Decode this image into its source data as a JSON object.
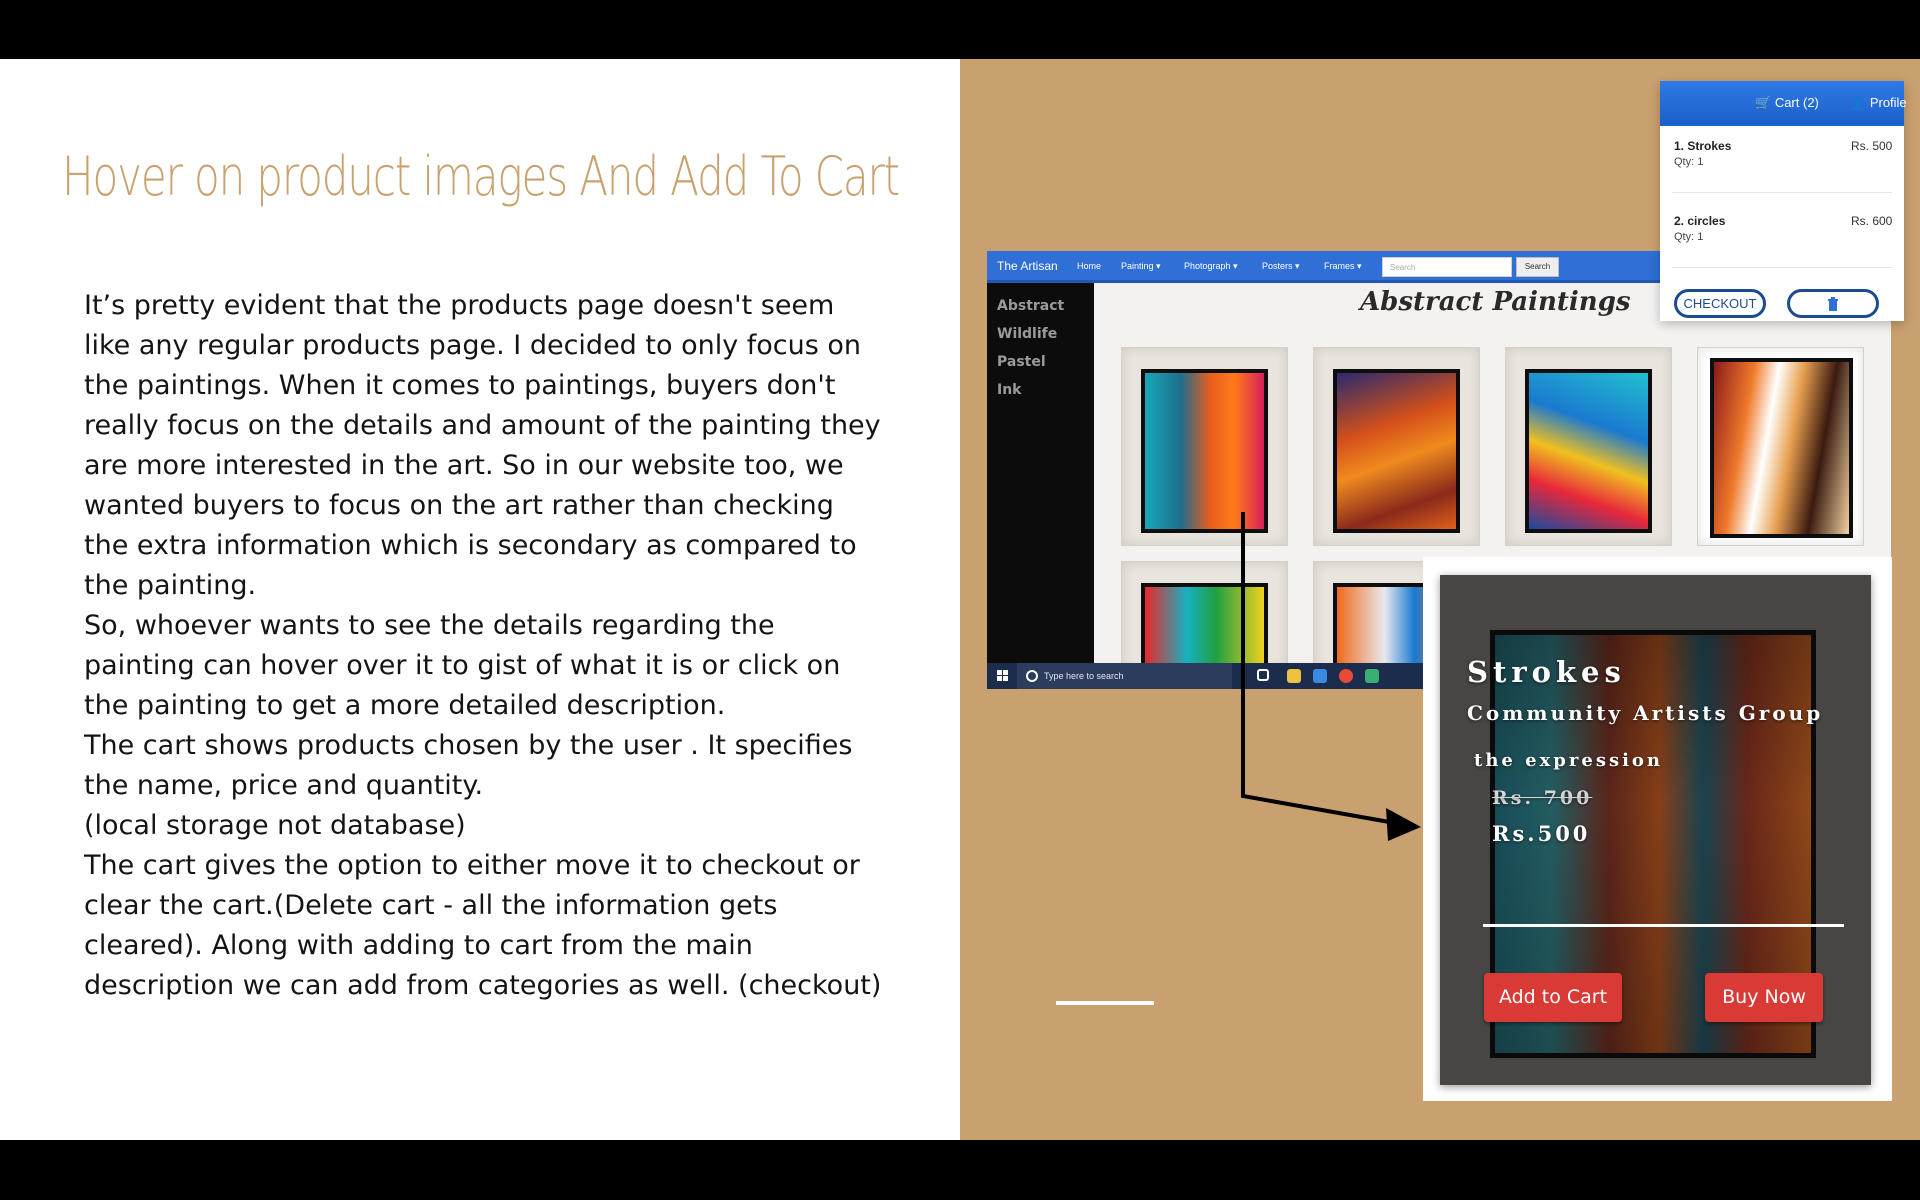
{
  "slide": {
    "title": "Hover on product images And Add To Cart",
    "paragraphs": [
      "It’s pretty evident that the products page doesn't seem like any regular products page. I decided to only focus on the paintings. When it comes to paintings, buyers don't really focus on the details and amount of the painting they are more interested in the art. So in our website too, we wanted buyers to focus on the art rather than checking the extra information which is secondary as compared to the painting.",
      "So, whoever wants to see the details regarding the painting can hover over it to gist of what it is or click on the painting to get a more detailed description.",
      "The cart shows products chosen by the user . It specifies the name, price and quantity.",
      "(local storage not database)",
      "The cart gives the option to either move it to checkout or clear the cart.(Delete cart -  all the information gets cleared). Along with adding to cart from the main description we can add from categories as well. (checkout)"
    ]
  },
  "site": {
    "brand": "The Artisan",
    "nav": [
      "Home",
      "Painting ▾",
      "Photograph ▾",
      "Posters ▾",
      "Frames ▾"
    ],
    "search_placeholder": "Search",
    "search_button": "Search",
    "sidebar": [
      "Abstract",
      "Wildlife",
      "Pastel",
      "Ink"
    ],
    "heading": "Abstract Paintings",
    "taskbar_search": "Type here to search"
  },
  "cart": {
    "cart_label": "Cart (2)",
    "profile_label": "Profile",
    "items": [
      {
        "name": "1. Strokes",
        "qty": "Qty: 1",
        "price": "Rs. 500"
      },
      {
        "name": "2. circles",
        "qty": "Qty: 1",
        "price": "Rs. 600"
      }
    ],
    "checkout": "CHECKOUT",
    "delete_icon": "trash-icon"
  },
  "hover_card": {
    "title": "Strokes",
    "artist": "Community Artists Group",
    "subtitle": "the expression",
    "old_price": "Rs. 700",
    "price": "Rs.500",
    "add_to_cart": "Add to Cart",
    "buy_now": "Buy Now"
  },
  "colors": {
    "title_accent": "#c9a16f",
    "right_panel": "#c9a16f",
    "nav_blue": "#2f6fd6",
    "button_red": "#d93a36"
  }
}
